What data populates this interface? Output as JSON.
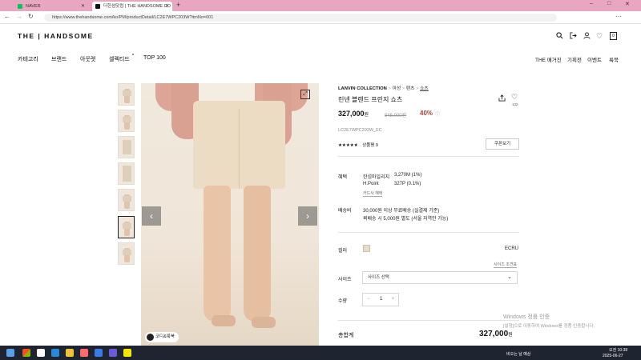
{
  "browser": {
    "tabs": [
      {
        "label": "NAVER",
        "active": false,
        "icon_color": "#03c75a"
      },
      {
        "label": "더한섬닷컴 | THE HANDSOME.CO",
        "active": true,
        "icon_color": "#111111"
      }
    ],
    "new_tab": "+",
    "url": "https://www.thehandsome.com/ko/PM/productDetail/LC2E7WPC203W?itmNo=001",
    "window_controls": [
      "–",
      "□",
      "✕"
    ]
  },
  "site": {
    "logo": "THE | HANDSOME",
    "header_icons": [
      "search-icon",
      "logout-icon",
      "user-icon",
      "heart-icon",
      "bag-icon"
    ],
    "bag_count": "0",
    "nav_left": [
      "카테고리",
      "브랜드",
      "아웃렛",
      "셀렉티드",
      "TOP 100"
    ],
    "nav_right": [
      "THE 매거진",
      "기획전",
      "이벤트",
      "룩북"
    ]
  },
  "gallery": {
    "thumbnail_count": 7,
    "selected_thumbnail": 6,
    "coordinate_button": "코디&룩북",
    "prev_arrow": "‹",
    "next_arrow": "›"
  },
  "product": {
    "breadcrumb": {
      "brand": "LANVIN COLLECTION",
      "path": [
        "여성",
        "팬츠",
        "쇼츠"
      ]
    },
    "title": "린넨 블렌드 프린지 쇼츠",
    "price": "327,000",
    "price_unit": "원",
    "original_price": "545,000원",
    "discount": "40%",
    "discount_info_icon": "ⓘ",
    "code": "LC2E7WPC203W_EC",
    "rating_stars": "★★★★★",
    "review_label": "상품평 9",
    "coupon_button": "쿠폰보기",
    "heart_count": "132",
    "benefits": {
      "label": "혜택",
      "rows": [
        {
          "name": "한섬마일리지",
          "value": "3,270M (1%)"
        },
        {
          "name": "H.Point",
          "value": "327P (0.1%)"
        }
      ],
      "card_link": "카드사 혜택"
    },
    "shipping": {
      "label": "배송비",
      "line1": "30,000원 이상 무료배송 (실결제 기준)",
      "line2": "퀵배송 시 5,000원 별도 (서울 지역만 가능)"
    },
    "color": {
      "label": "컬러",
      "value": "ECRU",
      "swatch": "#e9dcc6"
    },
    "size_guide_link": "사이즈 조견표",
    "size": {
      "label": "사이즈",
      "placeholder": "사이즈 선택"
    },
    "quantity": {
      "label": "수량",
      "minus": "−",
      "value": "1",
      "plus": "+"
    },
    "total": {
      "label": "총합계",
      "value": "327,000",
      "unit": "원"
    }
  },
  "watermark": {
    "line1": "Windows 정품 인증",
    "line2": "[설정]으로 이동하여 Windows를 정품 인증합니다."
  },
  "taskbar": {
    "weather": "비오는 날 예상",
    "time": "오전 10:38",
    "date": "2025-06-27"
  }
}
